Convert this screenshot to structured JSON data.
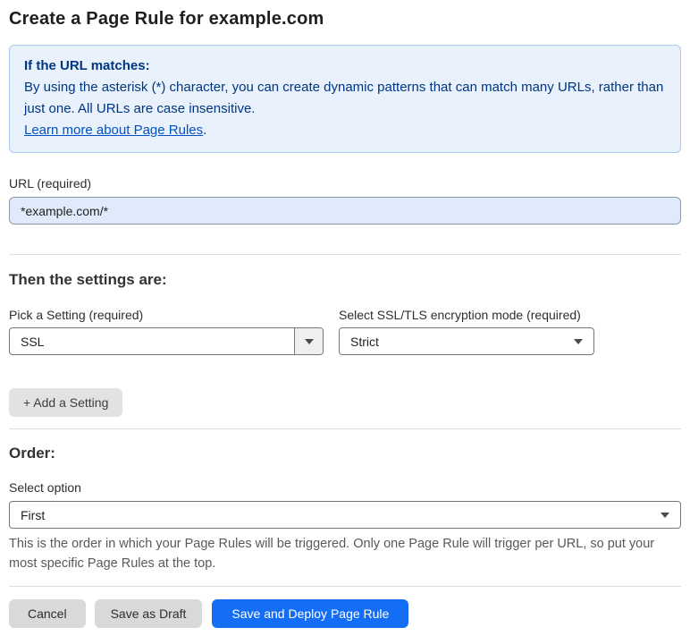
{
  "page": {
    "title": "Create a Page Rule for example.com"
  },
  "info_box": {
    "heading": "If the URL matches:",
    "body": "By using the asterisk (*) character, you can create dynamic patterns that can match many URLs, rather than just one. All URLs are case insensitive.",
    "link_label": "Learn more about Page Rules",
    "link_suffix": "."
  },
  "url_field": {
    "label": "URL (required)",
    "value": "*example.com/*"
  },
  "settings_section": {
    "heading": "Then the settings are:",
    "setting_select": {
      "label": "Pick a Setting (required)",
      "value": "SSL"
    },
    "mode_select": {
      "label": "Select SSL/TLS encryption mode (required)",
      "value": "Strict"
    },
    "add_setting_label": "+ Add a Setting"
  },
  "order_section": {
    "heading": "Order:",
    "select_label": "Select option",
    "select_value": "First",
    "help_text": "This is the order in which your Page Rules will be triggered. Only one Page Rule will trigger per URL, so put your most specific Page Rules at the top."
  },
  "footer": {
    "cancel_label": "Cancel",
    "save_draft_label": "Save as Draft",
    "save_deploy_label": "Save and Deploy Page Rule"
  },
  "colors": {
    "accent_blue": "#146ef5",
    "info_background": "#e8f1fc",
    "info_border": "#abc9ee",
    "info_text": "#003681",
    "link_blue": "#0051c3",
    "url_input_background": "#dfeafb"
  }
}
